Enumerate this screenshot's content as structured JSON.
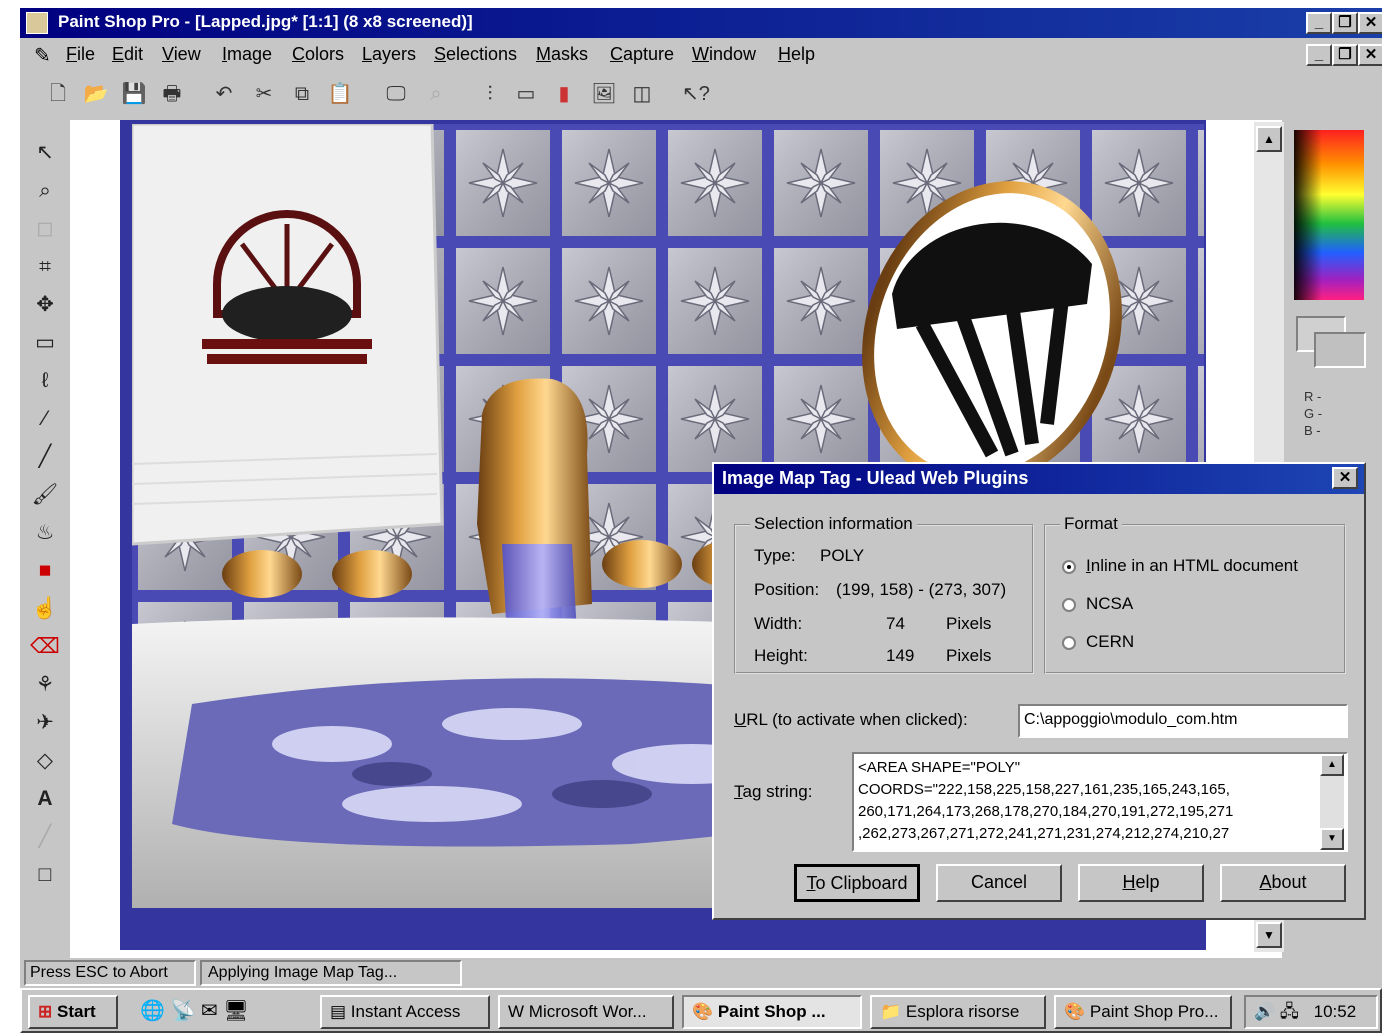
{
  "window": {
    "title": "Paint Shop Pro - [Lapped.jpg* [1:1] (8 x8 screened)]",
    "controls": [
      "_",
      "❐",
      "✕"
    ]
  },
  "menu": [
    "File",
    "Edit",
    "View",
    "Image",
    "Colors",
    "Layers",
    "Selections",
    "Masks",
    "Capture",
    "Window",
    "Help"
  ],
  "doc_controls": [
    "_",
    "❐",
    "✕"
  ],
  "dialog": {
    "title": "Image Map Tag - Ulead Web Plugins",
    "close": "✕",
    "selection_group": "Selection information",
    "type_label": "Type:",
    "type_value": "POLY",
    "position_label": "Position:",
    "position_value": "(199, 158) - (273, 307)",
    "width_label": "Width:",
    "width_value": "74",
    "height_label": "Height:",
    "height_value": "149",
    "unit": "Pixels",
    "format_group": "Format",
    "format_options": [
      "Inline in an HTML document",
      "NCSA",
      "CERN"
    ],
    "format_selected": 0,
    "url_label": "URL (to activate when clicked):",
    "url_value": "C:\\appoggio\\modulo_com.htm",
    "tag_label": "Tag string:",
    "tag_lines": [
      "<AREA SHAPE=\"POLY\"",
      "COORDS=\"222,158,225,158,227,161,235,165,243,165,",
      "260,171,264,173,268,178,270,184,270,191,272,195,271",
      ",262,273,267,271,272,241,271,231,274,212,274,210,27"
    ],
    "buttons": [
      "To Clipboard",
      "Cancel",
      "Help",
      "About"
    ]
  },
  "status": {
    "left": "Press ESC to Abort",
    "right": "Applying Image Map Tag..."
  },
  "taskbar": {
    "start": "Start",
    "tasks": [
      "Instant Access",
      "Microsoft Wor...",
      "Paint Shop ...",
      "Esplora risorse",
      "Paint Shop Pro..."
    ],
    "active": 2,
    "clock": "10:52"
  },
  "palette": {
    "rgb_labels": [
      "R -",
      "G -",
      "B -"
    ]
  },
  "colors": {
    "title_start": "#000080",
    "title_end": "#1e46b4",
    "chrome": "#c6c6c6",
    "image_border": "#3535a0"
  }
}
